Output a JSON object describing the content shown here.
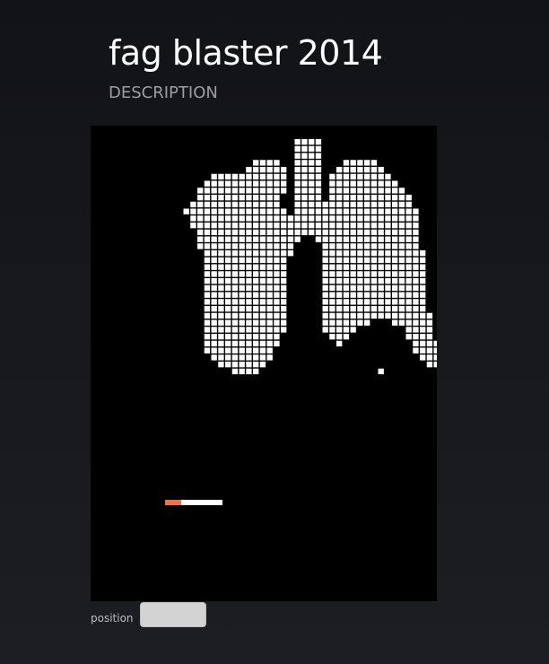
{
  "header": {
    "title": "fag blaster 2014",
    "subtitle": "DESCRIPTION"
  },
  "game": {
    "paddle_filter_color": "#e8744e",
    "paddle_body_color": "#ffffff",
    "brick_color": "#ffffff"
  },
  "controls": {
    "position_label": "position",
    "position_value": ""
  }
}
